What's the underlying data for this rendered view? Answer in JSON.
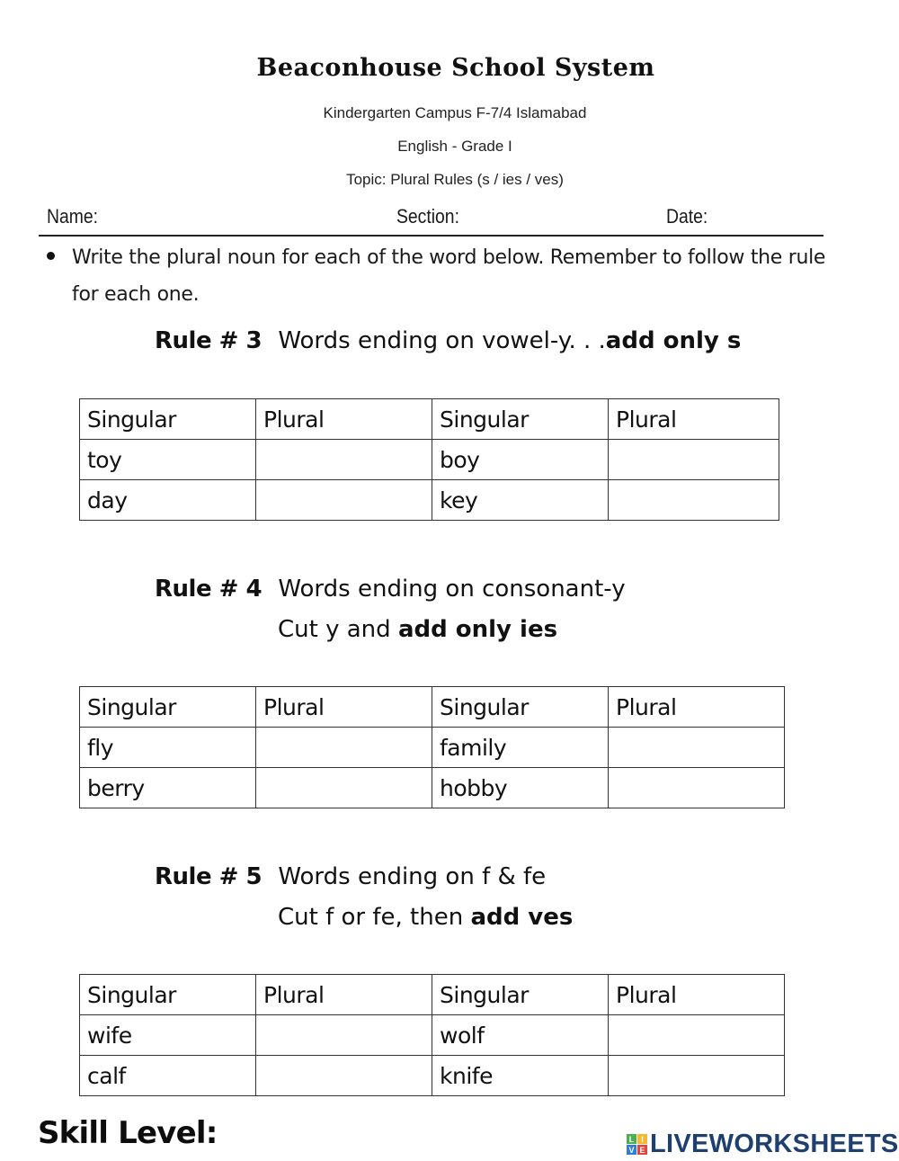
{
  "header": {
    "school": "Beaconhouse School System",
    "campus": "Kindergarten Campus F-7/4 Islamabad",
    "subject": "English - Grade I",
    "topic": "Topic: Plural Rules (s / ies / ves)"
  },
  "fields": {
    "name_label": "Name:",
    "section_label": "Section:",
    "date_label": "Date:"
  },
  "instructions": "Write the plural noun for each of the word below. Remember to follow the rule for each one.",
  "rules": [
    {
      "number": "Rule # 3",
      "line1": "Words ending on vowel-y. . .",
      "line1_bold": "add only s",
      "line2": "",
      "line2_bold": "",
      "table": {
        "headers": [
          "Singular",
          "Plural",
          "Singular",
          "Plural"
        ],
        "rows": [
          [
            "toy",
            "",
            "boy",
            ""
          ],
          [
            "day",
            "",
            "key",
            ""
          ]
        ]
      }
    },
    {
      "number": "Rule # 4",
      "line1": "Words ending on consonant-y",
      "line1_bold": "",
      "line2": "Cut y and ",
      "line2_bold": "add only ies",
      "table": {
        "headers": [
          "Singular",
          "Plural",
          "Singular",
          "Plural"
        ],
        "rows": [
          [
            "fly",
            "",
            "family",
            ""
          ],
          [
            "berry",
            "",
            "hobby",
            ""
          ]
        ]
      }
    },
    {
      "number": "Rule # 5",
      "line1": "Words ending on f & fe",
      "line1_bold": "",
      "line2": "Cut f or fe, then ",
      "line2_bold": "add ves",
      "table": {
        "headers": [
          "Singular",
          "Plural",
          "Singular",
          "Plural"
        ],
        "rows": [
          [
            "wife",
            "",
            "wolf",
            ""
          ],
          [
            "calf",
            "",
            "knife",
            ""
          ]
        ]
      }
    }
  ],
  "footer": {
    "skill_level": "Skill Level:",
    "brand": "LIVEWORKSHEETS",
    "logo_letters": [
      "L",
      "I",
      "V",
      "E"
    ],
    "logo_colors": [
      "#4caf50",
      "#f5b82e",
      "#2f7fd1",
      "#e8413c"
    ],
    "brand_color": "#1f3f6e"
  }
}
